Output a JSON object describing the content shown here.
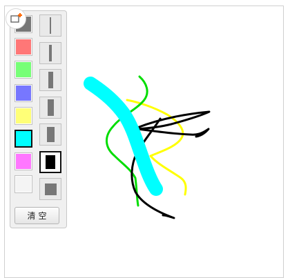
{
  "toolbox": {
    "toggle_icon": "pen-toolbox-icon",
    "colors": [
      {
        "name": "gray",
        "hex": "#777777",
        "selected": false
      },
      {
        "name": "red",
        "hex": "#ff7777",
        "selected": false
      },
      {
        "name": "green",
        "hex": "#77ff77",
        "selected": false
      },
      {
        "name": "blue",
        "hex": "#7777ff",
        "selected": false
      },
      {
        "name": "yellow",
        "hex": "#ffff77",
        "selected": false
      },
      {
        "name": "cyan",
        "hex": "#00ffff",
        "selected": true
      },
      {
        "name": "magenta",
        "hex": "#ff77ff",
        "selected": false
      },
      {
        "name": "white",
        "hex": "#f4f4f4",
        "selected": false
      }
    ],
    "sizes": [
      {
        "level": 1,
        "selected": false
      },
      {
        "level": 2,
        "selected": false
      },
      {
        "level": 3,
        "selected": false
      },
      {
        "level": 4,
        "selected": false
      },
      {
        "level": 5,
        "selected": false
      },
      {
        "level": 6,
        "selected": true
      },
      {
        "level": 7,
        "selected": false
      }
    ],
    "clear_label": "清空"
  },
  "strokes": [
    {
      "name": "yellow-stroke",
      "color": "#ffff00"
    },
    {
      "name": "green-stroke",
      "color": "#00dd00"
    },
    {
      "name": "black-stroke-upper",
      "color": "#000000"
    },
    {
      "name": "black-stroke-lower",
      "color": "#000000"
    },
    {
      "name": "cyan-stroke",
      "color": "#00ffff"
    }
  ]
}
